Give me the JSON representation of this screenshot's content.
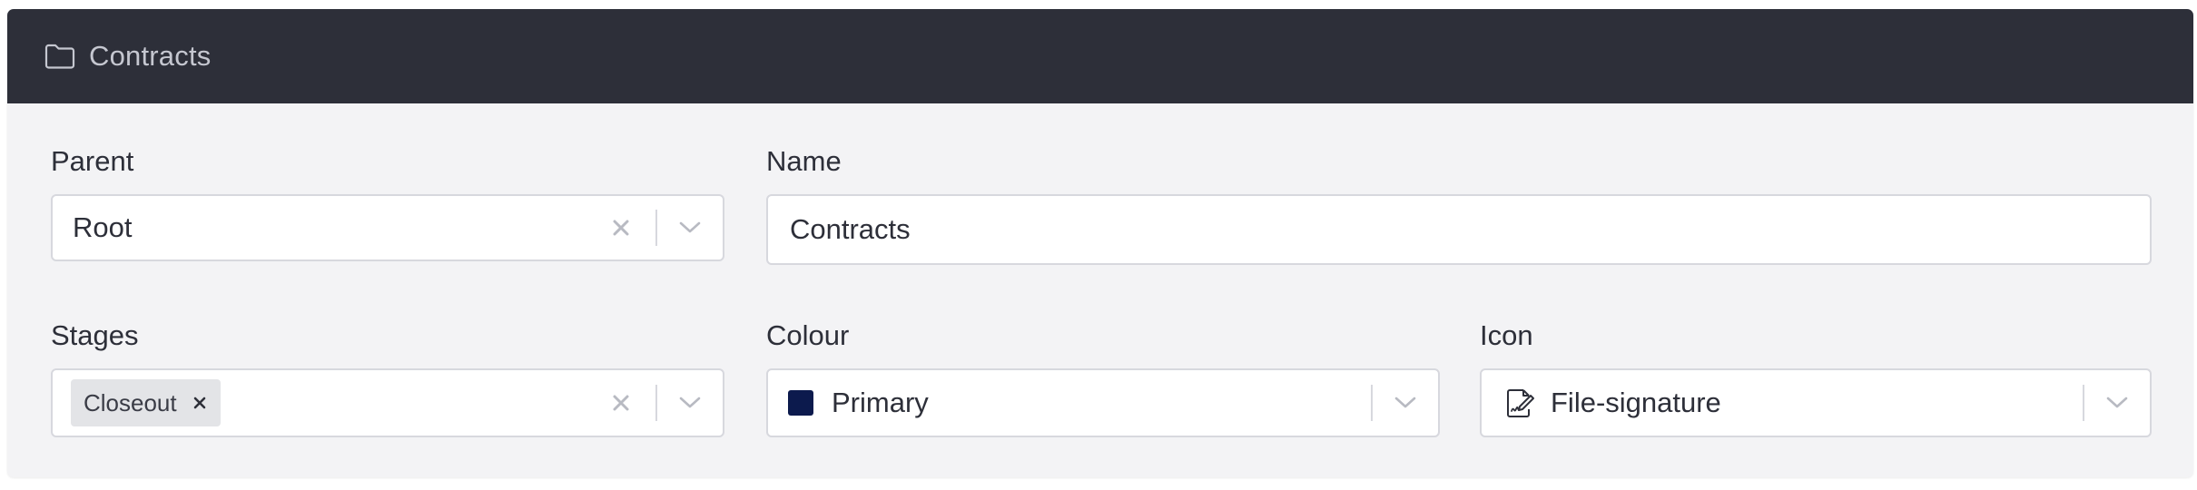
{
  "header": {
    "icon": "folder-icon",
    "title": "Contracts"
  },
  "form": {
    "parent": {
      "label": "Parent",
      "value": "Root"
    },
    "name": {
      "label": "Name",
      "value": "Contracts"
    },
    "stages": {
      "label": "Stages",
      "chips": [
        "Closeout"
      ]
    },
    "colour": {
      "label": "Colour",
      "value": "Primary",
      "swatch_color": "#0c1a4d"
    },
    "icon": {
      "label": "Icon",
      "value": "File-signature",
      "icon": "file-signature-icon"
    }
  },
  "colors": {
    "header_bg": "#2d2f39",
    "panel_bg": "#f3f3f5",
    "text": "#2d2f39",
    "muted_icon": "#b8bac2"
  }
}
